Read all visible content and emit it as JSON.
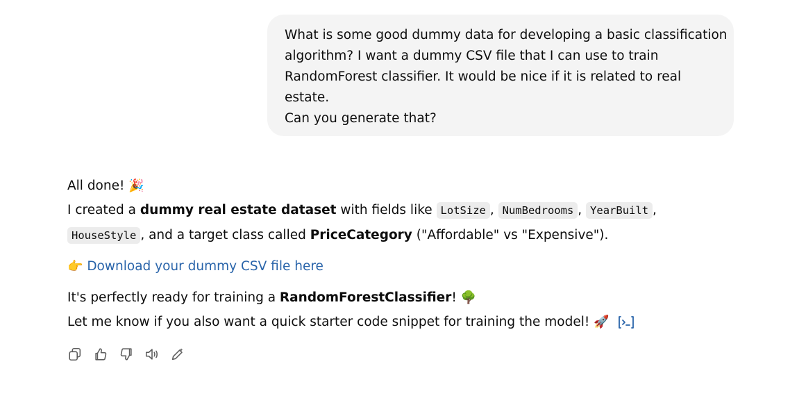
{
  "user_message": {
    "lines": [
      "What is some good dummy data for developing a basic classification",
      "algorithm? I want a dummy CSV file that I can use to train",
      "RandomForest classifier. It would be nice if it is related to real",
      "estate.",
      "Can you generate that?"
    ]
  },
  "assistant": {
    "line1_text": "All done! ",
    "line1_emoji": "🎉",
    "line2_prefix": "I created a ",
    "line2_bold": "dummy real estate dataset",
    "line2_mid": " with fields like ",
    "fields": [
      "LotSize",
      "NumBedrooms",
      "YearBuilt",
      "HouseStyle"
    ],
    "sep": ", ",
    "line3_mid": ", and a target class called ",
    "line3_bold": "PriceCategory",
    "line3_suffix": " (\"Affordable\" vs \"Expensive\").",
    "download_emoji": "👉",
    "download_link": "Download your dummy CSV file here",
    "line5_prefix": "It's perfectly ready for training a ",
    "line5_bold": "RandomForestClassifier",
    "line5_suffix": "! ",
    "line5_emoji": "🌳",
    "line6_text": "Let me know if you also want a quick starter code snippet for training the model! ",
    "line6_emoji": "🚀"
  },
  "colors": {
    "bubble_bg": "#f4f4f4",
    "link": "#2964aa",
    "code_bg": "#ececec",
    "icon": "#5d5d5d"
  },
  "icons": [
    "copy-icon",
    "thumbs-up-icon",
    "thumbs-down-icon",
    "read-aloud-icon",
    "edit-in-canvas-icon"
  ]
}
